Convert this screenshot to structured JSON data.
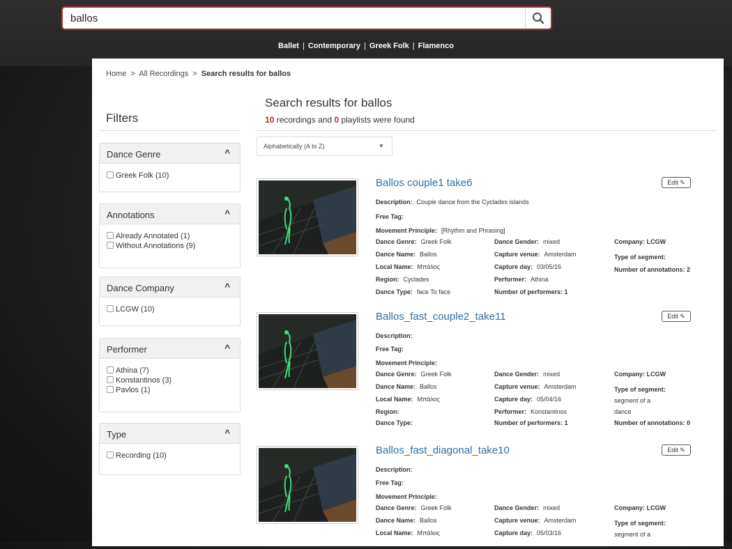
{
  "search": {
    "value": "ballos",
    "placeholder": ""
  },
  "top_nav": [
    "Ballet",
    "Contemporary",
    "Greek Folk",
    "Flamenco"
  ],
  "breadcrumb": {
    "home": "Home",
    "all": "All Recordings",
    "current": "Search results for ballos",
    "sep": ">"
  },
  "filters": {
    "title": "Filters",
    "groups": [
      {
        "label": "Dance Genre",
        "options": [
          "Greek Folk (10)"
        ]
      },
      {
        "label": "Annotations",
        "options": [
          "Already Annotated (1)",
          "Without Annotations (9)"
        ]
      },
      {
        "label": "Dance Company",
        "options": [
          "LCGW (10)"
        ]
      },
      {
        "label": "Performer",
        "options": [
          "Athina (7)",
          "Konstantinos (3)",
          "Pavlos (1)"
        ]
      },
      {
        "label": "Type",
        "options": [
          "Recording (10)"
        ]
      }
    ]
  },
  "results": {
    "title": "Search results for ballos",
    "recordings_count": "10",
    "recordings_text": "recordings and",
    "playlists_count": "0",
    "playlists_text": "playlists were found"
  },
  "sort": {
    "selected": "Alphabetically (A to Z)"
  },
  "edit_label": "Edit",
  "labels": {
    "description": "Description:",
    "free_tag": "Free Tag:",
    "movement": "Movement Principle:",
    "genre": "Dance Genre:",
    "name": "Dance Name:",
    "local": "Local Name:",
    "region": "Region:",
    "type": "Dance Type:",
    "gender": "Dance Gender:",
    "venue": "Capture venue:",
    "day": "Capture day:",
    "performer": "Performer:",
    "num_performers": "Number of performers: 1",
    "company": "Company: LCGW",
    "segment": "Type of segment:"
  },
  "recordings": [
    {
      "title": "Ballos couple1 take6",
      "description": "Couple dance from the Cyclades islands",
      "movement": "[Rhythm and Phrasing]",
      "genre": "Greek Folk",
      "name": "Ballos",
      "local": "Μπάλος",
      "region": "Cyclades",
      "type": "face To face",
      "gender": "mixed",
      "venue": "Amsterdam",
      "day": "03/05/16",
      "performer": "Athina",
      "segment_value": "",
      "annotations": "Number of annotations: 2"
    },
    {
      "title": "Ballos_fast_couple2_take11",
      "description": "",
      "movement": "",
      "genre": "Greek Folk",
      "name": "Ballos",
      "local": "Μπάλος",
      "region": "",
      "type": "",
      "gender": "mixed",
      "venue": "Amsterdam",
      "day": "05/04/16",
      "performer": "Konstantinos",
      "segment_value": "segment of a dance",
      "segment_line1": "segment of a",
      "segment_line2": "dance",
      "annotations": "Number of annotations: 0"
    },
    {
      "title": "Ballos_fast_diagonal_take10",
      "description": "",
      "movement": "",
      "genre": "Greek Folk",
      "name": "Ballos",
      "local": "Μπάλος",
      "gender": "mixed",
      "venue": "Amsterdam",
      "day": "05/03/16",
      "segment_line1": "segment of a"
    }
  ]
}
